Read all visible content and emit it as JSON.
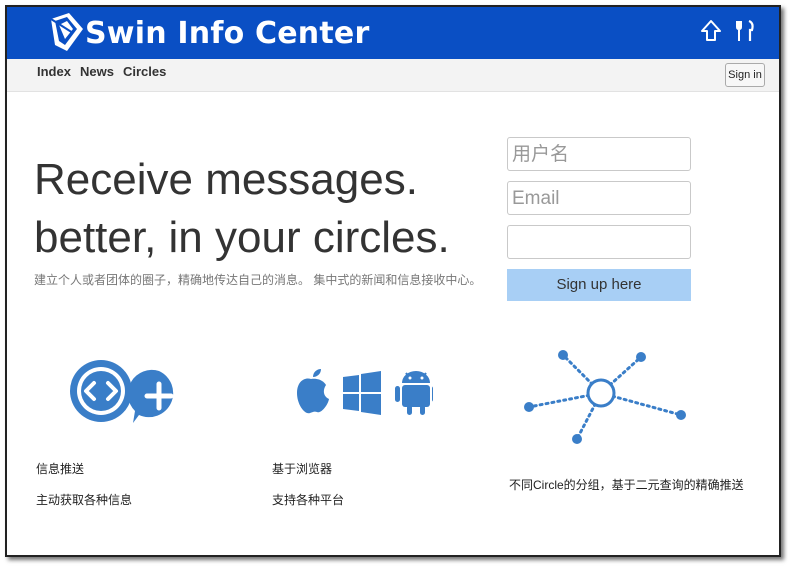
{
  "header": {
    "title": "Swin Info Center",
    "icons": [
      "upload-arrow-icon",
      "tools-icon"
    ],
    "brand_color": "#0a4fc4"
  },
  "nav": {
    "items": [
      "Index",
      "News",
      "Circles"
    ],
    "signin_label": "Sign in"
  },
  "hero": {
    "line1": "Receive messages.",
    "line2": "better, in your circles.",
    "subtitle": "建立个人或者团体的圈子，精确地传达自己的消息。 集中式的新闻和信息接收中心。"
  },
  "signup_form": {
    "username_placeholder": "用户名",
    "email_placeholder": "Email",
    "password_placeholder": "",
    "button_label": "Sign up here",
    "button_color": "#a8cff5"
  },
  "features": [
    {
      "icon": "code-plus-icon",
      "lines": [
        "信息推送",
        "主动获取各种信息"
      ]
    },
    {
      "icon": "platforms-icon",
      "lines": [
        "基于浏览器",
        "支持各种平台"
      ]
    },
    {
      "icon": "network-icon",
      "lines": [
        "不同Circle的分组，基于二元查询的精确推送"
      ]
    }
  ],
  "accent_color": "#3a7ec8"
}
